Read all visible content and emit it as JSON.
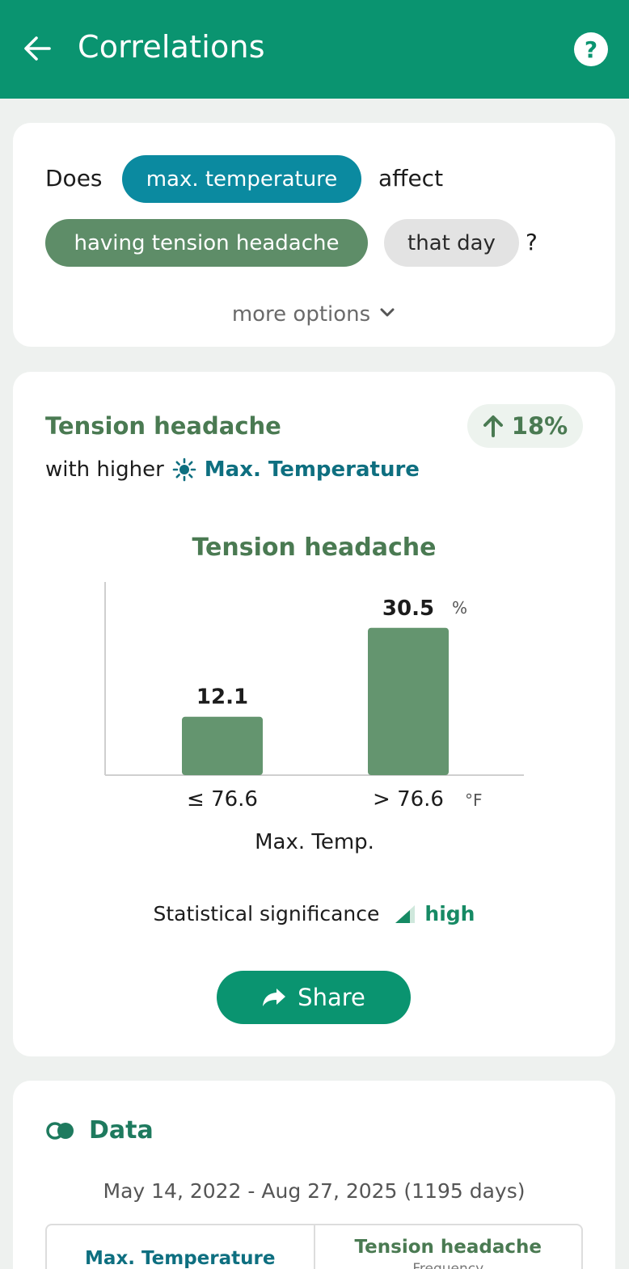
{
  "appbar": {
    "title": "Correlations",
    "help_label": "?",
    "background": "#0a9470"
  },
  "query": {
    "prefix": "Does",
    "factor_chip": "max. temperature",
    "verb": "affect",
    "symptom_chip": "having tension headache",
    "time_chip": "that day",
    "suffix": "?",
    "more_options": "more options"
  },
  "result": {
    "title": "Tension headache",
    "change_badge": "18%",
    "subtitle_prefix": "with higher",
    "factor_name": "Max. Temperature",
    "significance_label": "Statistical significance",
    "significance_value": "high",
    "share_label": "Share"
  },
  "chart_data": {
    "type": "bar",
    "title": "Tension headache",
    "categories": [
      "≤ 76.6",
      "> 76.6"
    ],
    "values": [
      12.1,
      30.5
    ],
    "value_labels": [
      "12.1",
      "30.5"
    ],
    "value_unit": "%",
    "x_unit": "°F",
    "xlabel": "Max. Temp.",
    "ylabel": "",
    "ylim": [
      0,
      40
    ],
    "bar_color": "#64956f",
    "grid": false
  },
  "data_section": {
    "title": "Data",
    "date_range": "May 14, 2022 - Aug 27, 2025 (1195 days)",
    "table": {
      "col1_header": "Max. Temperature",
      "col2_header": "Tension headache",
      "col2_subheader": "Frequency"
    }
  }
}
